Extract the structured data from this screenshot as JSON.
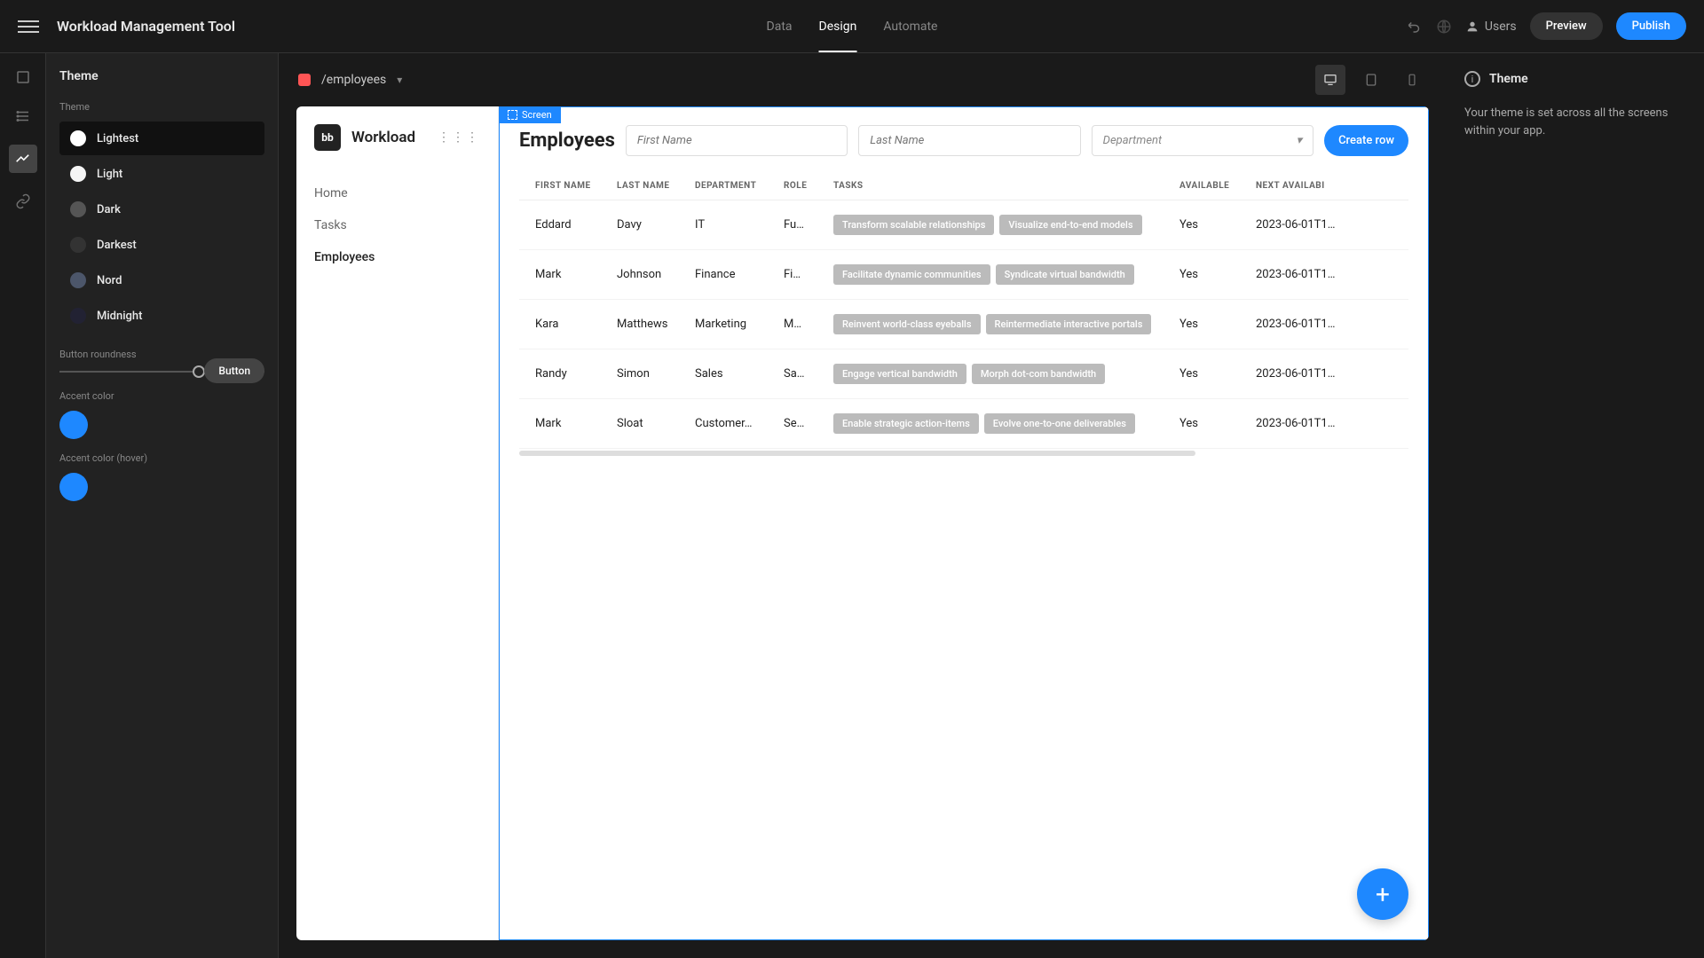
{
  "topbar": {
    "title": "Workload Management Tool",
    "tabs": [
      "Data",
      "Design",
      "Automate"
    ],
    "active_tab": 1,
    "users_label": "Users",
    "preview_label": "Preview",
    "publish_label": "Publish"
  },
  "theme_panel": {
    "title": "Theme",
    "theme_label": "Theme",
    "options": [
      {
        "name": "Lightest",
        "color": "#ffffff"
      },
      {
        "name": "Light",
        "color": "#f5f5f5"
      },
      {
        "name": "Dark",
        "color": "#555555"
      },
      {
        "name": "Darkest",
        "color": "#333333"
      },
      {
        "name": "Nord",
        "color": "#4c566a"
      },
      {
        "name": "Midnight",
        "color": "#222233"
      }
    ],
    "active_option": 0,
    "roundness_label": "Button roundness",
    "sample_button": "Button",
    "accent_label": "Accent color",
    "accent_hover_label": "Accent color (hover)",
    "accent_color": "#1e88ff"
  },
  "canvas_header": {
    "route": "/employees"
  },
  "app": {
    "logo_text": "bb",
    "name": "Workload",
    "nav": [
      "Home",
      "Tasks",
      "Employees"
    ],
    "active_nav": 2,
    "screen_tag": "Screen",
    "page_title": "Employees",
    "input_first_placeholder": "First Name",
    "input_last_placeholder": "Last Name",
    "select_dept_placeholder": "Department",
    "create_btn": "Create row",
    "columns": [
      "FIRST NAME",
      "LAST NAME",
      "DEPARTMENT",
      "ROLE",
      "TASKS",
      "AVAILABLE",
      "NEXT AVAILABI"
    ],
    "rows": [
      {
        "first": "Eddard",
        "last": "Davy",
        "dept": "IT",
        "role": "Fu…",
        "tasks": [
          "Transform scalable relationships",
          "Visualize end-to-end models"
        ],
        "avail": "Yes",
        "next": "2023-06-01T1…"
      },
      {
        "first": "Mark",
        "last": "Johnson",
        "dept": "Finance",
        "role": "Fi…",
        "tasks": [
          "Facilitate dynamic communities",
          "Syndicate virtual bandwidth"
        ],
        "avail": "Yes",
        "next": "2023-06-01T1…"
      },
      {
        "first": "Kara",
        "last": "Matthews",
        "dept": "Marketing",
        "role": "M…",
        "tasks": [
          "Reinvent world-class eyeballs",
          "Reintermediate interactive portals"
        ],
        "avail": "Yes",
        "next": "2023-06-01T1…"
      },
      {
        "first": "Randy",
        "last": "Simon",
        "dept": "Sales",
        "role": "Sa…",
        "tasks": [
          "Engage vertical bandwidth",
          "Morph dot-com bandwidth"
        ],
        "avail": "Yes",
        "next": "2023-06-01T1…"
      },
      {
        "first": "Mark",
        "last": "Sloat",
        "dept": "Customer…",
        "role": "Se…",
        "tasks": [
          "Enable strategic action-items",
          "Evolve one-to-one deliverables"
        ],
        "avail": "Yes",
        "next": "2023-06-01T1…"
      }
    ]
  },
  "right_panel": {
    "title": "Theme",
    "text": "Your theme is set across all the screens within your app."
  }
}
